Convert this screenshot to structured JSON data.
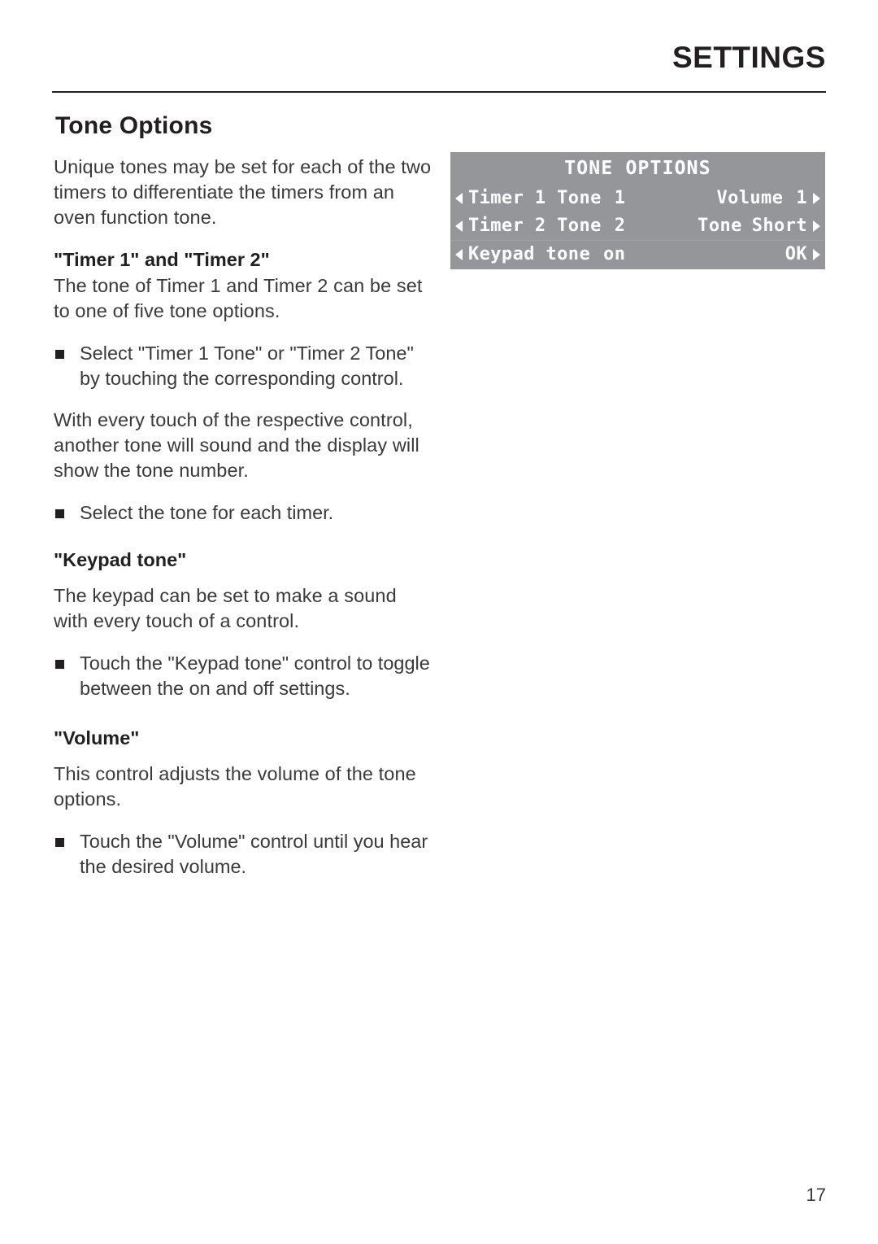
{
  "header": {
    "title": "SETTINGS"
  },
  "section": {
    "title": "Tone Options",
    "intro": "Unique tones may be set for each of the two timers to differentiate the timers from an oven function tone."
  },
  "blocks": {
    "timer_heading": "\"Timer 1\" and \"Timer 2\"",
    "timer_body": "The tone of Timer 1 and Timer 2 can be set to one of five tone options.",
    "timer_bullet_1": "Select \"Timer 1 Tone\" or \"Timer 2 Tone\" by touching the corresponding control.",
    "timer_body_2": "With every touch of the respective control, another tone will sound and the display will show the tone number.",
    "timer_bullet_2": "Select the tone for each timer.",
    "keypad_heading": "\"Keypad tone\"",
    "keypad_body": "The keypad can be set to make a sound with every touch of a control.",
    "keypad_bullet": "Touch the \"Keypad tone\" control to toggle between the on and off settings.",
    "volume_heading": "\"Volume\"",
    "volume_body": "This control adjusts the volume of the tone options.",
    "volume_bullet": "Touch the \"Volume\" control until you hear the desired volume."
  },
  "display": {
    "title": "TONE OPTIONS",
    "background_color": "#949699",
    "text_color": "#ffffff",
    "rows": [
      {
        "left_label": "Timer 1 Tone",
        "left_value": "1",
        "right_label": "Volume",
        "right_value": "1"
      },
      {
        "left_label": "Timer 2 Tone",
        "left_value": "2",
        "right_label": "Tone",
        "right_value": "Short"
      },
      {
        "left_label": "Keypad tone",
        "left_value": "on",
        "right_label": "",
        "right_value": "OK"
      }
    ]
  },
  "footer": {
    "page_number": "17"
  }
}
